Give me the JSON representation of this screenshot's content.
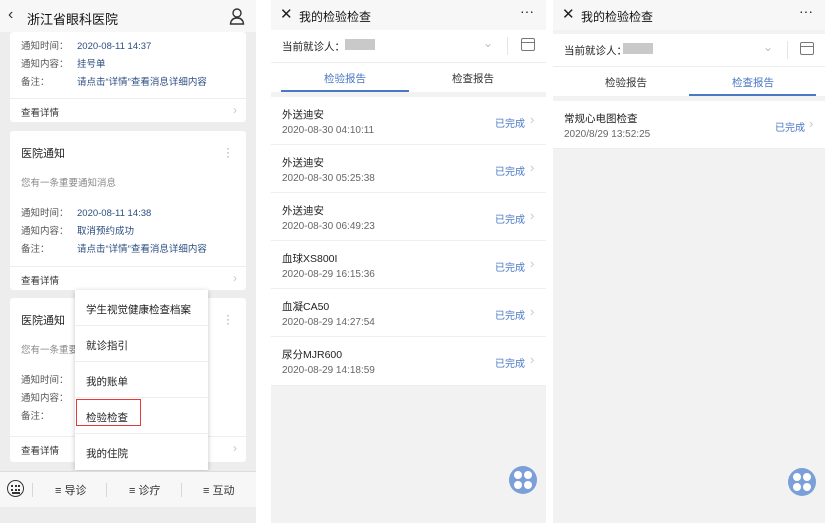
{
  "hospital_panel": {
    "header": {
      "back_icon": "chevron-left-icon",
      "title": "浙江省眼科医院",
      "user_icon": "user-icon"
    },
    "cards": [
      {
        "fields": [
          {
            "label": "通知时间：",
            "value": "2020-08-11 14:37"
          },
          {
            "label": "通知内容：",
            "value": "挂号单"
          },
          {
            "label": "备注：",
            "value": "请点击“详情”查看消息详细内容"
          }
        ],
        "link": "查看详情"
      },
      {
        "title": "医院通知",
        "subtitle": "您有一条重要通知消息",
        "fields": [
          {
            "label": "通知时间：",
            "value": "2020-08-11 14:38"
          },
          {
            "label": "通知内容：",
            "value": "取消预约成功"
          },
          {
            "label": "备注：",
            "value": "请点击“详情”查看消息详细内容"
          }
        ],
        "link": "查看详情"
      },
      {
        "title": "医院通知",
        "subtitle": "您有一条重要",
        "fields": [
          {
            "label": "通知时间："
          },
          {
            "label": "通知内容："
          },
          {
            "label": "备注："
          }
        ],
        "link": "查看详情"
      }
    ],
    "popup_menu": {
      "items": [
        "学生视觉健康检查档案",
        "就诊指引",
        "我的账单",
        "检验检查",
        "我的住院"
      ],
      "highlighted": "检验检查",
      "highlight_color": "#e13a3a"
    },
    "bottom_nav": {
      "keyboard_icon": "keyboard-icon",
      "items": [
        "≡ 导诊",
        "≡ 诊疗",
        "≡ 互动"
      ]
    }
  },
  "lab_panel": {
    "header": {
      "close_icon": "close-icon",
      "title": "我的检验检查",
      "more": "···"
    },
    "patient_label": "当前就诊人：",
    "tabs": [
      "检验报告",
      "检查报告"
    ],
    "active_tab": "检验报告",
    "records": [
      {
        "name": "外送迪安",
        "time": "2020-08-30 04:10:11",
        "status": "已完成"
      },
      {
        "name": "外送迪安",
        "time": "2020-08-30 05:25:38",
        "status": "已完成"
      },
      {
        "name": "外送迪安",
        "time": "2020-08-30 06:49:23",
        "status": "已完成"
      },
      {
        "name": "血球XS800I",
        "time": "2020-08-29 16:15:36",
        "status": "已完成"
      },
      {
        "name": "血凝CA50",
        "time": "2020-08-29 14:27:54",
        "status": "已完成"
      },
      {
        "name": "尿分MJR600",
        "time": "2020-08-29 14:18:59",
        "status": "已完成"
      }
    ]
  },
  "exam_panel": {
    "header": {
      "close_icon": "close-icon",
      "title": "我的检验检查",
      "more": "···"
    },
    "patient_label": "当前就诊人：",
    "tabs": [
      "检验报告",
      "检查报告"
    ],
    "active_tab": "检查报告",
    "records": [
      {
        "name": "常规心电图检查",
        "time": "2020/8/29 13:52:25",
        "status": "已完成"
      }
    ]
  },
  "colors": {
    "accent": "#4a78c4",
    "link_value": "#2a4d80",
    "fab": "#7b9fd9"
  }
}
